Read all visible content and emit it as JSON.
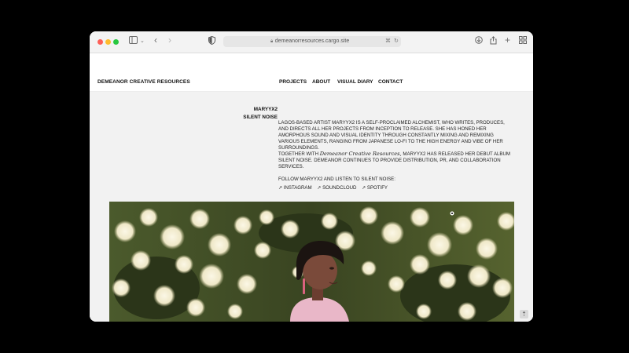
{
  "browser": {
    "url": "demeanorresources.cargo.site",
    "icons": {
      "sidebar": "sidebar-icon",
      "chevron": "chevron-down-icon",
      "back": "back-icon",
      "forward": "forward-icon",
      "shield": "shield-icon",
      "lock": "lock-icon",
      "translate": "translate-icon",
      "reload": "reload-icon",
      "download": "download-icon",
      "share": "share-icon",
      "new_tab": "plus-icon",
      "tabs": "tab-overview-icon"
    }
  },
  "site": {
    "brand": "DEMEANOR CREATIVE RESOURCES",
    "nav": [
      "PROJECTS",
      "ABOUT",
      "VISUAL DIARY",
      "CONTACT"
    ]
  },
  "project": {
    "artist": "MARYYX2",
    "release": "SILENT NOISE",
    "intro": "LAGOS-BASED ARTIST MARYYX2 IS A SELF-PROCLAIMED ALCHEMIST, WHO WRITES, PRODUCES, AND DIRECTS ALL HER PROJECTS FROM INCEPTION TO RELEASE. SHE HAS HONED HER AMORPHOUS SOUND AND VISUAL IDENTITY THROUGH CONSTANTLY MIXING AND REMIXING VARIOUS ELEMENTS, RANGING FROM JAPANESE LO-FI TO THE HIGH ENERGY AND VIBE OF HER SURROUNDINGS.",
    "together_prefix": "TOGETHER WITH",
    "together_script": "Demeanor Creative Resources,",
    "together_suffix": "MARYYX2 HAS RELEASED HER DEBUT ALBUM SILENT NOISE. DEMEANOR CONTINUES TO PROVIDE DISTRIBUTION, PR, AND COLLABORATION SERVICES.",
    "follow": "FOLLOW MARYYX2 AND LISTEN TO SILENT NOISE:",
    "links": [
      "↗ INSTAGRAM",
      "↗ SOUNDCLOUD",
      "↗ SPOTIFY"
    ]
  },
  "colors": {
    "foliage": "#3d4a24",
    "blossom": "#f4efd8",
    "skin": "#7a4a3a",
    "hair": "#1b1411",
    "top": "#e9b7c8"
  }
}
